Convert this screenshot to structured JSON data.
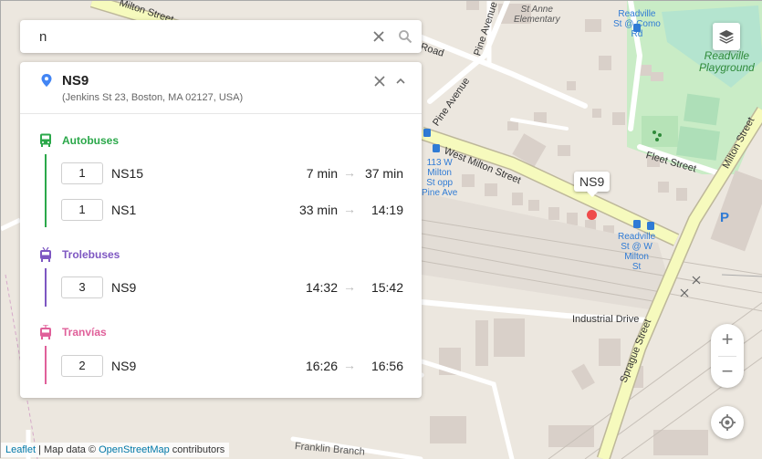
{
  "search": {
    "value": "n"
  },
  "panel": {
    "stop_name": "NS9",
    "address": "(Jenkins St 23, Boston, MA 02127, USA)",
    "sections": [
      {
        "title": "Autobuses",
        "color": "#2ba84a",
        "icon": "bus-icon",
        "rows": [
          {
            "count": "1",
            "line": "NS15",
            "from": "7 min",
            "to": "37 min"
          },
          {
            "count": "1",
            "line": "NS1",
            "from": "33 min",
            "to": "14:19"
          }
        ]
      },
      {
        "title": "Trolebuses",
        "color": "#7e57c2",
        "icon": "trolleybus-icon",
        "rows": [
          {
            "count": "3",
            "line": "NS9",
            "from": "14:32",
            "to": "15:42"
          }
        ]
      },
      {
        "title": "Tranvías",
        "color": "#e0609a",
        "icon": "tram-icon",
        "rows": [
          {
            "count": "2",
            "line": "NS9",
            "from": "16:26",
            "to": "16:56"
          }
        ]
      }
    ]
  },
  "map": {
    "marker_label": "NS9",
    "labels": {
      "st_anne": "St Anne\nElementary",
      "readville_como": "Readville\nSt @ Como\nRd",
      "readville_playground": "Readville\nPlayground",
      "pine_avenue_top": "Pine Avenue",
      "pine_avenue": "Pine Avenue",
      "milton_street_top": "Milton Street",
      "west_milton_street": "West Milton Street",
      "milton_street_right": "Milton Street",
      "fleet_street": "Fleet Street",
      "road": "Road",
      "stop_113": "113 W\nMilton\nSt opp\nPine Ave",
      "readville_w_milton": "Readville\nSt @ W\nMilton\nSt",
      "industrial_drive": "Industrial Drive",
      "sprague_street": "Sprague Street",
      "franklin_branch": "Franklin Branch",
      "parking": "P"
    },
    "zoom_in": "+",
    "zoom_out": "−"
  },
  "attribution": {
    "leaflet": "Leaflet",
    "separator": " | Map data © ",
    "osm": "OpenStreetMap",
    "suffix": " contributors"
  },
  "colors": {
    "accent": "#4285f4",
    "marker": "#ef4b4b"
  }
}
